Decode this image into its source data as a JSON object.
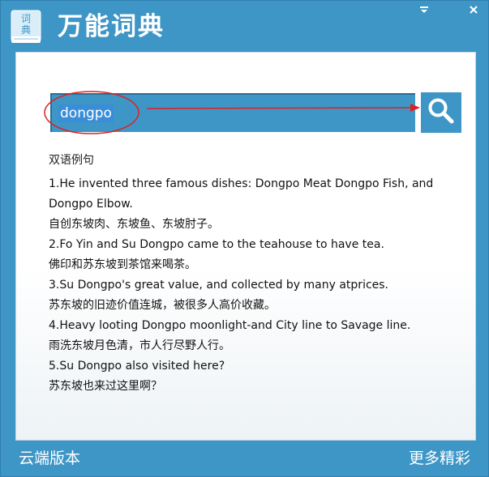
{
  "app": {
    "title": "万能词典",
    "icon_chars": [
      "词",
      "典"
    ]
  },
  "window_controls": {
    "minimize_icon": "minimize-icon",
    "close_icon": "close-icon"
  },
  "search": {
    "value": "dongpo",
    "button_icon": "search-icon"
  },
  "results": {
    "section_title": "双语例句",
    "lines": [
      "1.He invented three famous dishes: Dongpo Meat Dongpo Fish, and Dongpo Elbow.",
      "自创东坡肉、东坡鱼、东坡肘子。",
      "2.Fo Yin and Su Dongpo came to the teahouse to have tea.",
      "佛印和苏东坡到茶馆来喝茶。",
      "3.Su Dongpo's great value, and collected by many atprices.",
      "苏东坡的旧迹价值连城，被很多人高价收藏。",
      "4.Heavy looting Dongpo moonlight-and City line to Savage line.",
      "雨洗东坡月色清，市人行尽野人行。",
      "5.Su Dongpo also visited here?",
      "苏东坡也来过这里啊？"
    ]
  },
  "footer": {
    "left_label": "云端版本",
    "right_label": "更多精彩"
  },
  "colors": {
    "window": "#3d96c6",
    "annotation": "#e02020",
    "panel": "#ffffff"
  }
}
